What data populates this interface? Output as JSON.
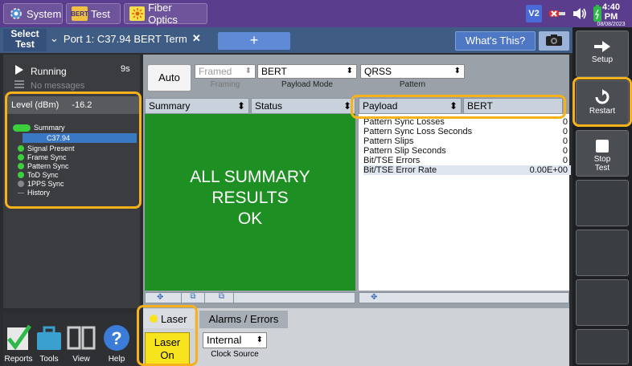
{
  "topbar": {
    "system_label": "System",
    "test_label": "Test",
    "test_icon_text": "BERT",
    "fiber_label": "Fiber Optics",
    "v2_label": "V2",
    "time": "4:40 PM",
    "date": "08/08/2023"
  },
  "tabs": {
    "select_test": "Select Test",
    "port_tab": "Port 1: C37.94 BERT Term",
    "add_tab": "+",
    "whats_this": "What's This?"
  },
  "left": {
    "status": "Running",
    "elapsed": "9s",
    "messages": "No messages",
    "level_label": "Level (dBm)",
    "level_value": "-16.2",
    "tree": {
      "summary": "Summary",
      "c37": "C37.94",
      "signal_present": "Signal Present",
      "frame_sync": "Frame Sync",
      "pattern_sync": "Pattern Sync",
      "tod_sync": "ToD Sync",
      "pps_sync": "1PPS Sync",
      "history": "History"
    }
  },
  "config": {
    "auto": "Auto",
    "framing_value": "Framed",
    "framing_label": "Framing",
    "payload_mode_value": "BERT",
    "payload_mode_label": "Payload Mode",
    "pattern_value": "QRSS",
    "pattern_label": "Pattern"
  },
  "summary_pane": {
    "header_left": "Summary",
    "header_right": "Status",
    "text_line1": "ALL SUMMARY",
    "text_line2": "RESULTS",
    "text_line3": "OK"
  },
  "results_pane": {
    "header_left": "Payload",
    "header_right": "BERT",
    "rows": [
      {
        "label": "Pattern Sync Losses",
        "value": "0"
      },
      {
        "label": "Pattern Sync Loss Seconds",
        "value": "0"
      },
      {
        "label": "Pattern Slips",
        "value": "0"
      },
      {
        "label": "Pattern Slip Seconds",
        "value": "0"
      },
      {
        "label": "Bit/TSE Errors",
        "value": "0"
      },
      {
        "label": "Bit/TSE Error Rate",
        "value": "0.00E+00"
      }
    ]
  },
  "bottom": {
    "laser_tab": "Laser",
    "alarms_tab": "Alarms / Errors",
    "laser_on_line1": "Laser",
    "laser_on_line2": "On",
    "clock_value": "Internal",
    "clock_label": "Clock Source"
  },
  "toolbar_bottom": {
    "reports": "Reports",
    "tools": "Tools",
    "view": "View",
    "help": "Help"
  },
  "right": {
    "setup": "Setup",
    "restart": "Restart",
    "stop_test_line1": "Stop",
    "stop_test_line2": "Test"
  },
  "colors": {
    "accent_purple": "#5a3d8c",
    "summary_green": "#1e8f22",
    "highlight": "#f7b21b",
    "laser_yellow": "#f8e31f"
  }
}
